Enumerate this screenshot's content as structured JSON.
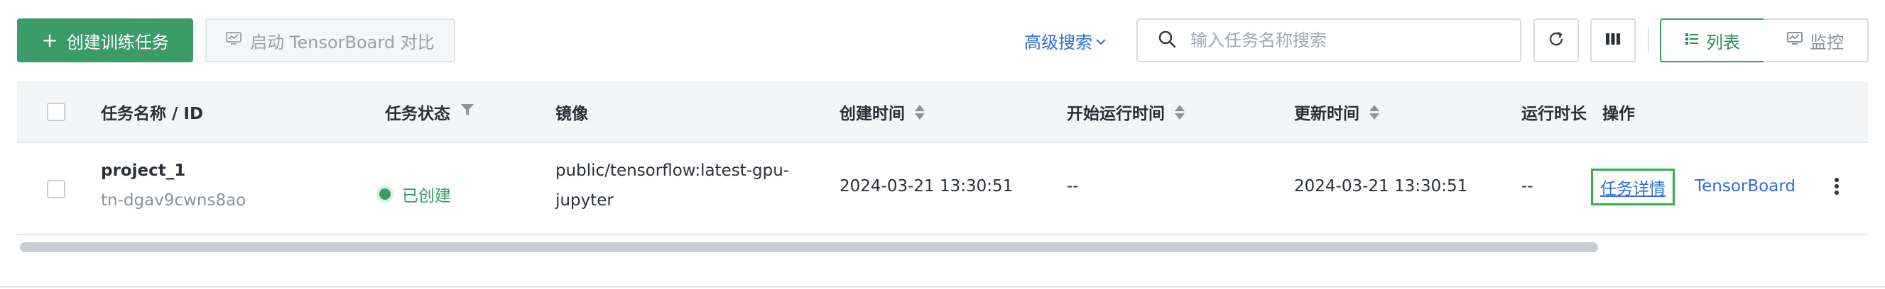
{
  "toolbar": {
    "create_label": "创建训练任务",
    "create_icon": "plus-icon",
    "tensorboard_compare_label": "启动 TensorBoard 对比",
    "advanced_search_label": "高级搜索",
    "search_placeholder": "输入任务名称搜索",
    "view_list_label": "列表",
    "view_monitor_label": "监控"
  },
  "table": {
    "headers": {
      "name": "任务名称 / ID",
      "status": "任务状态",
      "image": "镜像",
      "created": "创建时间",
      "started": "开始运行时间",
      "updated": "更新时间",
      "duration": "运行时长",
      "actions": "操作"
    },
    "rows": [
      {
        "name": "project_1",
        "id": "tn-dgav9cwns8ao",
        "status": "已创建",
        "image_line1": "public/tensorflow:latest-gpu-",
        "image_line2": "jupyter",
        "created": "2024-03-21 13:30:51",
        "started": "--",
        "updated": "2024-03-21 13:30:51",
        "duration": "--",
        "action_detail": "任务详情",
        "action_tensorboard": "TensorBoard"
      }
    ]
  },
  "colors": {
    "primary": "#3b9c6a",
    "link": "#2e6fd4",
    "status_ok": "#3b9c6a",
    "focus_outline": "#2fb24a"
  }
}
